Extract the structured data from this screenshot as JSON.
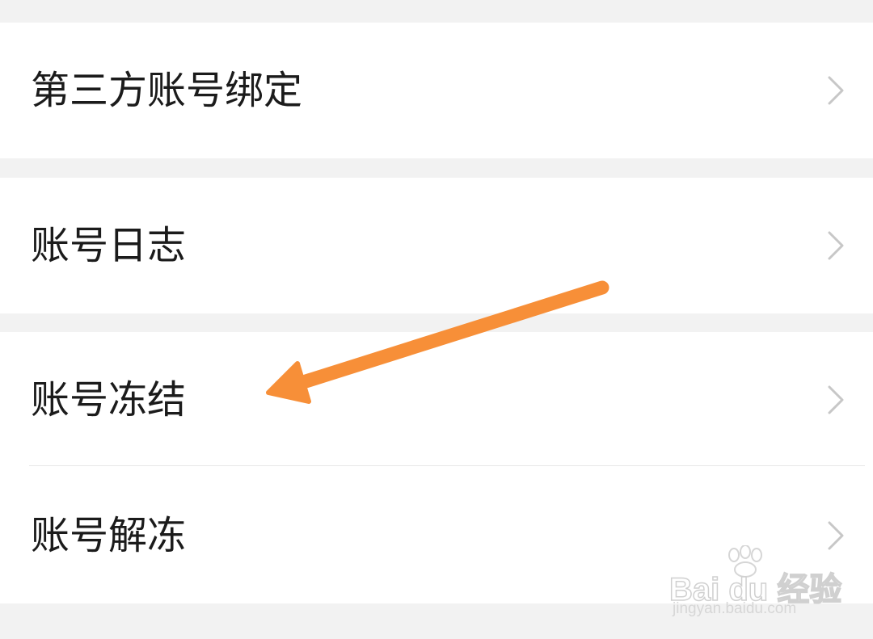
{
  "settings": {
    "items": [
      {
        "label": "第三方账号绑定",
        "icon": "chevron-right-icon"
      },
      {
        "label": "账号日志",
        "icon": "chevron-right-icon"
      },
      {
        "label": "账号冻结",
        "icon": "chevron-right-icon"
      },
      {
        "label": "账号解冻",
        "icon": "chevron-right-icon"
      }
    ]
  },
  "annotation": {
    "type": "arrow",
    "color": "#f78f38",
    "points_to": "账号冻结"
  },
  "watermark": {
    "logo": "Bai du 经验",
    "url": "jingyan.baidu.com"
  },
  "colors": {
    "background": "#f2f2f2",
    "row_background": "#ffffff",
    "text": "#1b1b1b",
    "chevron": "#c7c7c7",
    "divider": "#e8e8e8"
  }
}
